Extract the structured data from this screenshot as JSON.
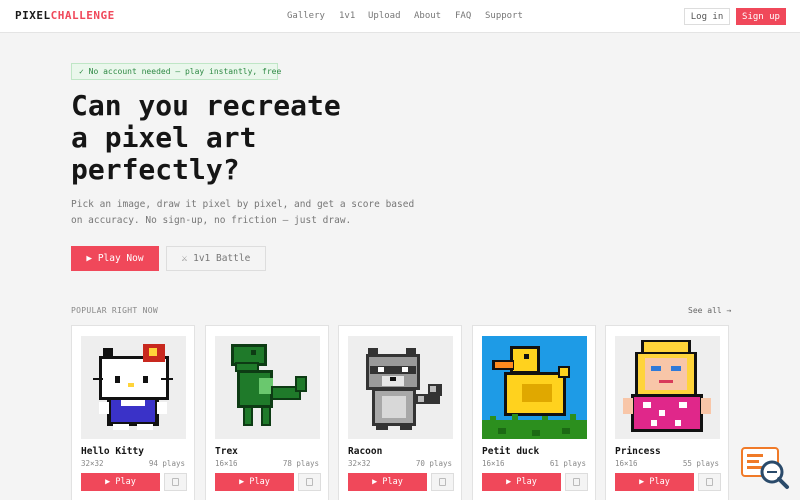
{
  "brand": {
    "part1": "PIXEL",
    "part2": "CHALLENGE",
    "accent": "#f0485a"
  },
  "nav": [
    "Gallery",
    "1v1",
    "Upload",
    "About",
    "FAQ",
    "Support"
  ],
  "auth": {
    "login": "Log in",
    "signup": "Sign up"
  },
  "hero": {
    "badge": "✓ No account needed — play instantly, free",
    "title": "Can you recreate\na pixel art\nperfectly?",
    "subtitle": "Pick an image, draw it pixel by pixel, and get a score based on accuracy. No sign-up, no friction — just draw.",
    "play_button": "▶ Play Now",
    "battle_button": "⚔ 1v1 Battle"
  },
  "popular": {
    "label": "POPULAR RIGHT NOW",
    "see_all": "See all →",
    "cards": [
      {
        "name": "Hello Kitty",
        "size": "32×32",
        "plays": "94 plays",
        "play": "▶ Play"
      },
      {
        "name": "Trex",
        "size": "16×16",
        "plays": "78 plays",
        "play": "▶ Play"
      },
      {
        "name": "Racoon",
        "size": "32×32",
        "plays": "70 plays",
        "play": "▶ Play"
      },
      {
        "name": "Petit duck",
        "size": "16×16",
        "plays": "61 plays",
        "play": "▶ Play"
      },
      {
        "name": "Princess",
        "size": "16×16",
        "plays": "55 plays",
        "play": "▶ Play"
      }
    ]
  },
  "icons": {
    "favorite": "bookmark-icon",
    "widget": "search-chat-icon"
  }
}
